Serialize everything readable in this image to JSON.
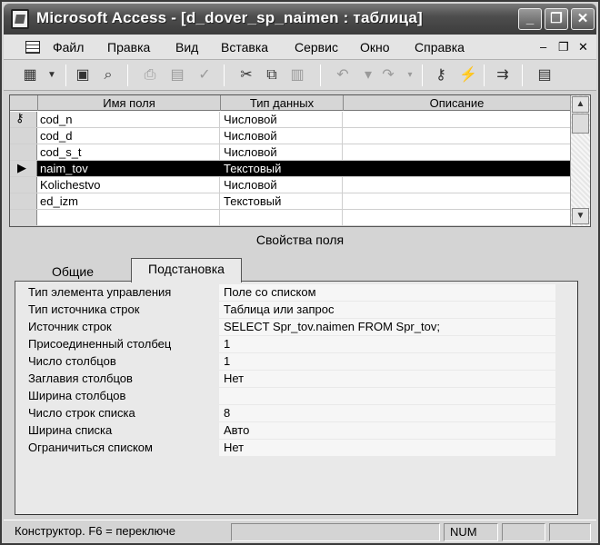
{
  "window": {
    "title": "Microsoft Access - [d_dover_sp_naimen : таблица]",
    "buttons": {
      "minimize": "_",
      "restore": "❐",
      "close": "✕"
    }
  },
  "menubar": {
    "items": [
      {
        "label": "Файл"
      },
      {
        "label": "Правка"
      },
      {
        "label": "Вид"
      },
      {
        "label": "Вставка"
      },
      {
        "label": "Сервис"
      },
      {
        "label": "Окно"
      },
      {
        "label": "Справка"
      }
    ],
    "doc_controls": {
      "minimize": "–",
      "restore": "❐",
      "close": "✕"
    }
  },
  "toolbar": {
    "icons": [
      "view-icon",
      "dropdown-arrow-icon",
      "save-icon",
      "search-icon",
      "print-icon",
      "print-preview-icon",
      "spelling-icon",
      "cut-icon",
      "copy-icon",
      "paste-icon",
      "undo-icon",
      "redo-icon",
      "primary-key-icon",
      "indexes-icon",
      "insert-rows-icon",
      "properties-icon"
    ]
  },
  "grid": {
    "headers": [
      "Имя поля",
      "Тип данных",
      "Описание"
    ],
    "rows": [
      {
        "name": "cod_n",
        "type": "Числовой",
        "description": "",
        "key": true,
        "current": false
      },
      {
        "name": "cod_d",
        "type": "Числовой",
        "description": "",
        "key": false,
        "current": false
      },
      {
        "name": "cod_s_t",
        "type": "Числовой",
        "description": "",
        "key": false,
        "current": false
      },
      {
        "name": "naim_tov",
        "type": "Текстовый",
        "description": "",
        "key": false,
        "current": true
      },
      {
        "name": "Kolichestvo",
        "type": "Числовой",
        "description": "",
        "key": false,
        "current": false
      },
      {
        "name": "ed_izm",
        "type": "Текстовый",
        "description": "",
        "key": false,
        "current": false
      },
      {
        "name": "",
        "type": "",
        "description": "",
        "key": false,
        "current": false
      },
      {
        "name": "",
        "type": "",
        "description": "",
        "key": false,
        "current": false
      }
    ]
  },
  "properties": {
    "title": "Свойства поля",
    "tabs": [
      {
        "label": "Общие",
        "active": false
      },
      {
        "label": "Подстановка",
        "active": true
      }
    ],
    "rows": [
      {
        "label": "Тип элемента управления",
        "value": "Поле со списком"
      },
      {
        "label": "Тип источника строк",
        "value": "Таблица или запрос"
      },
      {
        "label": "Источник строк",
        "value": "SELECT Spr_tov.naimen FROM Spr_tov;"
      },
      {
        "label": "Присоединенный столбец",
        "value": "1"
      },
      {
        "label": "Число столбцов",
        "value": "1"
      },
      {
        "label": "Заглавия столбцов",
        "value": "Нет"
      },
      {
        "label": "Ширина столбцов",
        "value": ""
      },
      {
        "label": "Число строк списка",
        "value": "8"
      },
      {
        "label": "Ширина списка",
        "value": "Авто"
      },
      {
        "label": "Ограничиться списком",
        "value": "Нет"
      }
    ]
  },
  "statusbar": {
    "message": "Конструктор.  F6 = переключе",
    "num": "NUM"
  }
}
